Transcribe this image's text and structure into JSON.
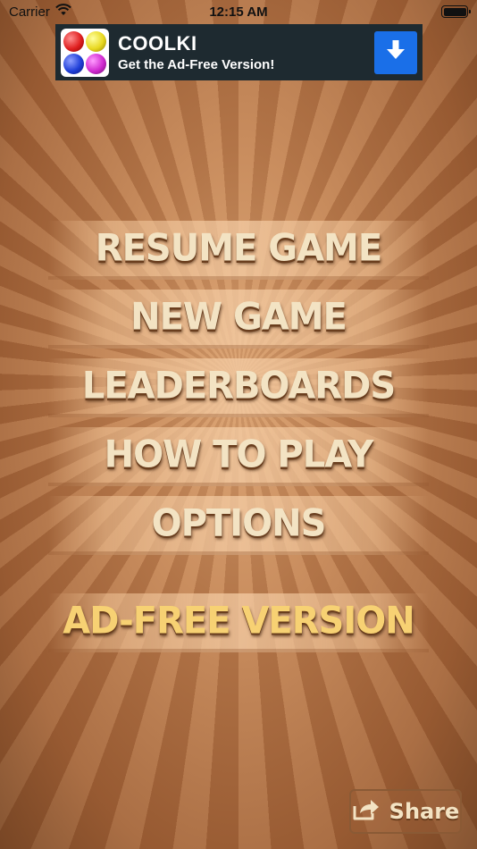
{
  "status_bar": {
    "carrier": "Carrier",
    "time": "12:15 AM"
  },
  "ad": {
    "title": "COOLKI",
    "subtitle": "Get the Ad-Free Version!",
    "ball_colors": [
      "#e02020",
      "#e8d820",
      "#1f3fd8",
      "#d02ad0"
    ],
    "download_icon": "arrow-down-icon",
    "accent": "#1a6fe8"
  },
  "menu": {
    "items": [
      {
        "label": "RESUME GAME"
      },
      {
        "label": "NEW GAME"
      },
      {
        "label": "LEADERBOARDS"
      },
      {
        "label": "HOW TO PLAY"
      },
      {
        "label": "OPTIONS"
      },
      {
        "label": "AD-FREE VERSION"
      }
    ]
  },
  "share": {
    "label": "Share",
    "icon": "share-icon"
  },
  "colors": {
    "menu_text": "#f3e3c3",
    "ad_free_text": "#f7d173"
  }
}
